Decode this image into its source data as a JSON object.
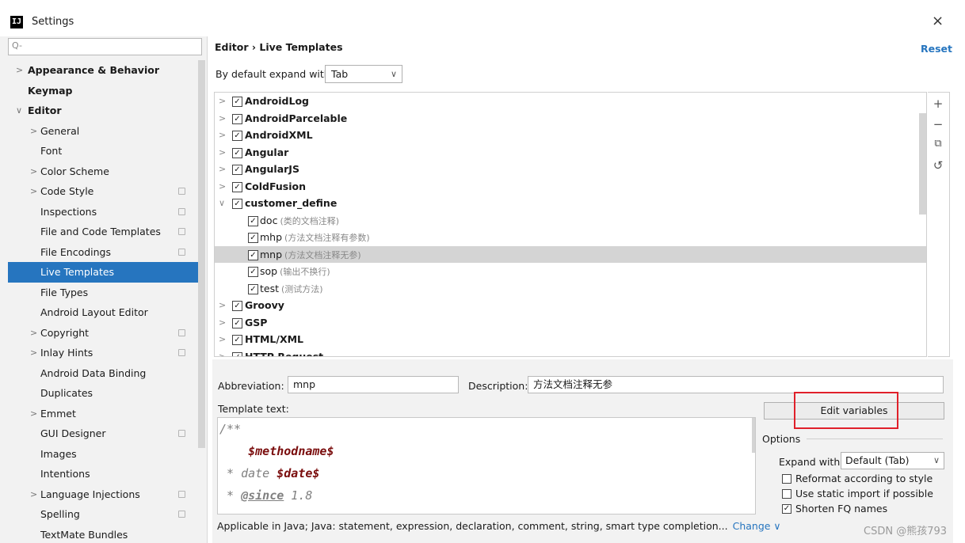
{
  "window": {
    "icon": "IJ",
    "title": "Settings",
    "close_glyph": "×"
  },
  "sidebar": {
    "search_glyph": "Q-",
    "items": [
      {
        "label": "Appearance & Behavior",
        "arrow": ">",
        "level": 0,
        "bold": true,
        "badge": false,
        "selected": false
      },
      {
        "label": "Keymap",
        "arrow": "",
        "level": 0,
        "bold": true,
        "badge": false,
        "selected": false
      },
      {
        "label": "Editor",
        "arrow": "∨",
        "level": 0,
        "bold": true,
        "badge": false,
        "selected": false
      },
      {
        "label": "General",
        "arrow": ">",
        "level": 1,
        "bold": false,
        "badge": false,
        "selected": false
      },
      {
        "label": "Font",
        "arrow": "",
        "level": 1,
        "bold": false,
        "badge": false,
        "selected": false
      },
      {
        "label": "Color Scheme",
        "arrow": ">",
        "level": 1,
        "bold": false,
        "badge": false,
        "selected": false
      },
      {
        "label": "Code Style",
        "arrow": ">",
        "level": 1,
        "bold": false,
        "badge": true,
        "selected": false
      },
      {
        "label": "Inspections",
        "arrow": "",
        "level": 1,
        "bold": false,
        "badge": true,
        "selected": false
      },
      {
        "label": "File and Code Templates",
        "arrow": "",
        "level": 1,
        "bold": false,
        "badge": true,
        "selected": false
      },
      {
        "label": "File Encodings",
        "arrow": "",
        "level": 1,
        "bold": false,
        "badge": true,
        "selected": false
      },
      {
        "label": "Live Templates",
        "arrow": "",
        "level": 1,
        "bold": false,
        "badge": false,
        "selected": true
      },
      {
        "label": "File Types",
        "arrow": "",
        "level": 1,
        "bold": false,
        "badge": false,
        "selected": false
      },
      {
        "label": "Android Layout Editor",
        "arrow": "",
        "level": 1,
        "bold": false,
        "badge": false,
        "selected": false
      },
      {
        "label": "Copyright",
        "arrow": ">",
        "level": 1,
        "bold": false,
        "badge": true,
        "selected": false
      },
      {
        "label": "Inlay Hints",
        "arrow": ">",
        "level": 1,
        "bold": false,
        "badge": true,
        "selected": false
      },
      {
        "label": "Android Data Binding",
        "arrow": "",
        "level": 1,
        "bold": false,
        "badge": false,
        "selected": false
      },
      {
        "label": "Duplicates",
        "arrow": "",
        "level": 1,
        "bold": false,
        "badge": false,
        "selected": false
      },
      {
        "label": "Emmet",
        "arrow": ">",
        "level": 1,
        "bold": false,
        "badge": false,
        "selected": false
      },
      {
        "label": "GUI Designer",
        "arrow": "",
        "level": 1,
        "bold": false,
        "badge": true,
        "selected": false
      },
      {
        "label": "Images",
        "arrow": "",
        "level": 1,
        "bold": false,
        "badge": false,
        "selected": false
      },
      {
        "label": "Intentions",
        "arrow": "",
        "level": 1,
        "bold": false,
        "badge": false,
        "selected": false
      },
      {
        "label": "Language Injections",
        "arrow": ">",
        "level": 1,
        "bold": false,
        "badge": true,
        "selected": false
      },
      {
        "label": "Spelling",
        "arrow": "",
        "level": 1,
        "bold": false,
        "badge": true,
        "selected": false
      },
      {
        "label": "TextMate Bundles",
        "arrow": "",
        "level": 1,
        "bold": false,
        "badge": false,
        "selected": false
      }
    ]
  },
  "header": {
    "breadcrumb": "Editor › Live Templates",
    "reset": "Reset",
    "expand_label": "By default expand with",
    "expand_value": "Tab",
    "chevron": "∨"
  },
  "tree": {
    "rows": [
      {
        "label": "AndroidLog",
        "desc": "",
        "arrow": ">",
        "level": 0,
        "checked": true,
        "selected": false
      },
      {
        "label": "AndroidParcelable",
        "desc": "",
        "arrow": ">",
        "level": 0,
        "checked": true,
        "selected": false
      },
      {
        "label": "AndroidXML",
        "desc": "",
        "arrow": ">",
        "level": 0,
        "checked": true,
        "selected": false
      },
      {
        "label": "Angular",
        "desc": "",
        "arrow": ">",
        "level": 0,
        "checked": true,
        "selected": false
      },
      {
        "label": "AngularJS",
        "desc": "",
        "arrow": ">",
        "level": 0,
        "checked": true,
        "selected": false
      },
      {
        "label": "ColdFusion",
        "desc": "",
        "arrow": ">",
        "level": 0,
        "checked": true,
        "selected": false
      },
      {
        "label": "customer_define",
        "desc": "",
        "arrow": "∨",
        "level": 0,
        "checked": true,
        "selected": false
      },
      {
        "label": "doc",
        "desc": "(类的文档注释)",
        "arrow": "",
        "level": 1,
        "checked": true,
        "selected": false
      },
      {
        "label": "mhp",
        "desc": "(方法文档注释有参数)",
        "arrow": "",
        "level": 1,
        "checked": true,
        "selected": false
      },
      {
        "label": "mnp",
        "desc": "(方法文档注释无参)",
        "arrow": "",
        "level": 1,
        "checked": true,
        "selected": true
      },
      {
        "label": "sop",
        "desc": "(输出不换行)",
        "arrow": "",
        "level": 1,
        "checked": true,
        "selected": false
      },
      {
        "label": "test",
        "desc": "(测试方法)",
        "arrow": "",
        "level": 1,
        "checked": true,
        "selected": false
      },
      {
        "label": "Groovy",
        "desc": "",
        "arrow": ">",
        "level": 0,
        "checked": true,
        "selected": false
      },
      {
        "label": "GSP",
        "desc": "",
        "arrow": ">",
        "level": 0,
        "checked": true,
        "selected": false
      },
      {
        "label": "HTML/XML",
        "desc": "",
        "arrow": ">",
        "level": 0,
        "checked": true,
        "selected": false
      },
      {
        "label": "HTTP Request",
        "desc": "",
        "arrow": ">",
        "level": 0,
        "checked": true,
        "selected": false
      }
    ],
    "toolbar": {
      "add": "+",
      "remove": "−",
      "copy": "⧉",
      "restore": "↺"
    }
  },
  "detail": {
    "abbreviation_label": "Abbreviation:",
    "abbreviation_value": "mnp",
    "description_label": "Description:",
    "description_value": "方法文档注释无参",
    "template_text_label": "Template text:",
    "code": {
      "line1": "/**",
      "line2_var": "$methodname$",
      "line3_prefix": " * date ",
      "line3_var": "$date$",
      "line4_prefix": " * ",
      "line4_tag": "@since",
      "line4_suffix": " 1.8"
    },
    "edit_variables": "Edit variables",
    "options_label": "Options",
    "expand_with_label": "Expand with",
    "expand_with_value": "Default (Tab)",
    "chevron": "∨",
    "options": [
      {
        "label": "Reformat according to style",
        "checked": false
      },
      {
        "label": "Use static import if possible",
        "checked": false
      },
      {
        "label": "Shorten FQ names",
        "checked": true
      }
    ],
    "applicable_text": "Applicable in Java; Java: statement, expression, declaration, comment, string, smart type completion...",
    "change_link": "Change ∨"
  },
  "watermark": "CSDN @熊孩793"
}
